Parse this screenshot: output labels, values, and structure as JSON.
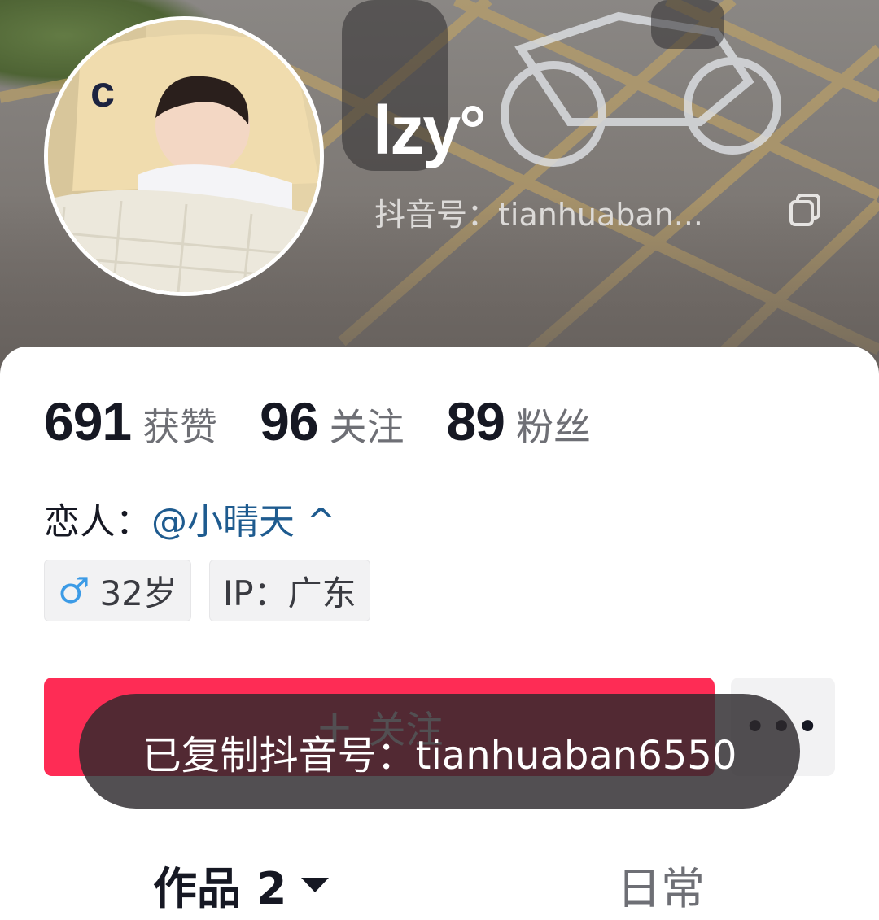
{
  "profile": {
    "name": "lzy°",
    "douyin_id": "抖音号：tianhuaban...",
    "stats": [
      {
        "num": "691",
        "label": "获赞"
      },
      {
        "num": "96",
        "label": "关注"
      },
      {
        "num": "89",
        "label": "粉丝"
      }
    ],
    "lover_label": "恋人：",
    "lover_link": "@小晴天 ^",
    "tags": [
      {
        "icon": "male-icon",
        "icon_glyph": "♂",
        "text": "32岁"
      },
      {
        "text": "IP：广东"
      }
    ]
  },
  "actions": {
    "follow_plus": "+",
    "follow_label": "关注",
    "more_label": "•••"
  },
  "toast": {
    "text": "已复制抖音号：tianhuaban6550"
  },
  "tabs": {
    "works": "作品 2",
    "daily": "日常"
  },
  "colors": {
    "accent": "#fe2c55",
    "link": "#1e5b8f",
    "text_primary": "#161823",
    "text_secondary": "#6e6f75"
  }
}
